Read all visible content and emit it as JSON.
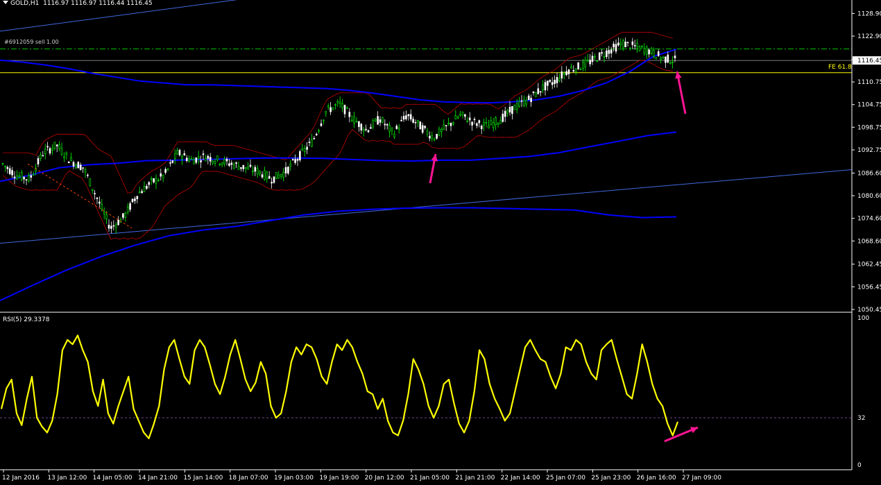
{
  "header": {
    "symbol": "GOLD,H1",
    "ohlc": "1116.97 1116.97 1116.44 1116.45"
  },
  "order_label": "#6912059 sell 1.00",
  "fe_label": "FE 61.8",
  "rsi_label": "RSI(5) 29.3378",
  "colors": {
    "background": "#000000",
    "bull_candle": "#00ff00",
    "bear_candle": "#ffffff",
    "bollinger": "#c00000",
    "moving_average": "#0000ff",
    "trendline": "#4169e1",
    "fe_level": "#ffff00",
    "order_line": "#00c000",
    "rsi_line": "#ffff00",
    "rsi_level": "#9b59b6",
    "arrow": "#ff1493"
  },
  "chart_data": [
    {
      "type": "candlestick",
      "title": "GOLD,H1",
      "ylim": [
        1050.45,
        1131
      ],
      "y_ticks": [
        "1128.90",
        "1122.90",
        "1116.75",
        "1110.75",
        "1104.75",
        "1098.75",
        "1092.75",
        "1086.60",
        "1080.60",
        "1074.60",
        "1068.60",
        "1062.45",
        "1056.45",
        "1050.45"
      ],
      "current_price": "1116.45",
      "x_ticks": [
        "12 Jan 2016",
        "13 Jan 12:00",
        "14 Jan 05:00",
        "14 Jan 21:00",
        "15 Jan 14:00",
        "18 Jan 07:00",
        "19 Jan 03:00",
        "19 Jan 19:00",
        "20 Jan 12:00",
        "21 Jan 05:00",
        "21 Jan 21:00",
        "22 Jan 14:00",
        "25 Jan 07:00",
        "25 Jan 23:00",
        "26 Jan 16:00",
        "27 Jan 09:00"
      ],
      "price_path": [
        1089,
        1086,
        1085,
        1092,
        1094,
        1090,
        1088,
        1080,
        1072,
        1075,
        1081,
        1084,
        1086,
        1092,
        1090,
        1091,
        1090,
        1089,
        1088,
        1087,
        1085,
        1087,
        1091,
        1095,
        1103,
        1105,
        1101,
        1098,
        1101,
        1097,
        1102,
        1099,
        1096,
        1099,
        1102,
        1100,
        1099,
        1101,
        1104,
        1106,
        1109,
        1111,
        1114,
        1115,
        1117,
        1119,
        1121,
        1120,
        1119,
        1117,
        1116.45
      ],
      "horizontal_levels": {
        "fe_61_8": 1113.2,
        "order_price": 1119.5
      },
      "moving_averages": [
        {
          "name": "",
          "values": [
            1116.5,
            1116,
            1115.2,
            1114.2,
            1113,
            1112,
            1111,
            1110.5,
            1110,
            1110,
            1109.8,
            1109.6,
            1109.4,
            1109.2,
            1109,
            1108.5,
            1107.8,
            1106.9,
            1106,
            1105.5,
            1105.3,
            1105.2,
            1105.5,
            1106,
            1107,
            1108.5,
            1110.5,
            1113.5,
            1117.5,
            1119.4
          ]
        },
        {
          "name": "",
          "values": [
            1084.4,
            1086,
            1088,
            1088.8,
            1089.2,
            1089.9,
            1090,
            1090.2,
            1090.4,
            1090.6,
            1090.6,
            1090.5,
            1090.2,
            1089.9,
            1089.8,
            1090,
            1090,
            1090.5,
            1091,
            1092,
            1093.5,
            1095,
            1096.5,
            1097.5
          ]
        },
        {
          "name": "",
          "values": [
            1052.8,
            1057,
            1061,
            1064.5,
            1067.5,
            1070,
            1071.5,
            1072.5,
            1074,
            1075.5,
            1076.5,
            1077,
            1077.3,
            1077.4,
            1077.4,
            1077.2,
            1077,
            1076.8,
            1075.5,
            1074.8,
            1075
          ]
        }
      ],
      "trendlines": [
        {
          "from": [
            0,
            1068
          ],
          "to": [
            1,
            1087.5
          ]
        },
        {
          "from": [
            0,
            1124.2
          ],
          "to": [
            1,
            1133
          ]
        }
      ]
    },
    {
      "type": "line",
      "title": "RSI(5) 29.3378",
      "ylim": [
        0,
        100
      ],
      "y_ticks": [
        "100",
        "32",
        "0"
      ],
      "level": 32,
      "values": [
        38,
        52,
        58,
        35,
        27,
        45,
        60,
        32,
        26,
        22,
        30,
        48,
        78,
        85,
        82,
        88,
        78,
        70,
        50,
        40,
        58,
        35,
        28,
        40,
        50,
        60,
        38,
        30,
        22,
        18,
        28,
        40,
        65,
        80,
        85,
        72,
        60,
        55,
        78,
        85,
        80,
        68,
        55,
        48,
        60,
        75,
        85,
        72,
        58,
        50,
        56,
        70,
        62,
        40,
        32,
        35,
        50,
        70,
        80,
        75,
        82,
        80,
        72,
        60,
        55,
        70,
        82,
        78,
        85,
        80,
        70,
        62,
        50,
        48,
        38,
        45,
        30,
        22,
        20,
        30,
        48,
        72,
        65,
        55,
        40,
        32,
        40,
        55,
        58,
        42,
        28,
        22,
        30,
        50,
        78,
        72,
        55,
        45,
        38,
        30,
        35,
        50,
        65,
        80,
        85,
        78,
        72,
        70,
        60,
        52,
        62,
        80,
        78,
        85,
        82,
        70,
        62,
        58,
        78,
        82,
        85,
        72,
        60,
        48,
        45,
        62,
        82,
        70,
        55,
        45,
        40,
        28,
        20,
        29.3
      ]
    }
  ]
}
